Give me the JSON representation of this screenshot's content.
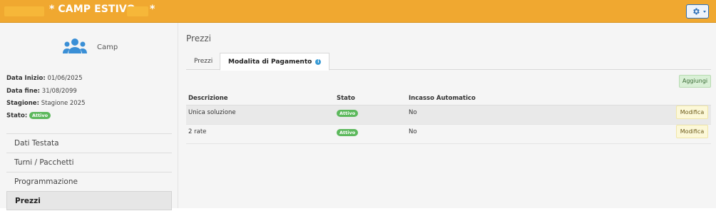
{
  "header": {
    "title": "* CAMP ESTIVO",
    "title_suffix": "*",
    "settings_icon": "gear-icon",
    "accent_color": "#f0a830"
  },
  "sidebar": {
    "icon": "users-icon",
    "camp_label": "Camp",
    "info": {
      "start_label": "Data Inizio:",
      "start_value": "01/06/2025",
      "end_label": "Data fine:",
      "end_value": "31/08/2099",
      "season_label": "Stagione:",
      "season_value": "Stagione 2025",
      "status_label": "Stato:",
      "status_value": "Attivo"
    },
    "menu": [
      {
        "label": "Dati Testata"
      },
      {
        "label": "Turni / Pacchetti"
      },
      {
        "label": "Programmazione"
      },
      {
        "label": "Prezzi"
      }
    ]
  },
  "main": {
    "title": "Prezzi",
    "tabs": [
      {
        "label": "Prezzi"
      },
      {
        "label": "Modalita di Pagamento",
        "icon": "info-icon"
      }
    ],
    "add_button": "Aggiungi",
    "table": {
      "headers": [
        "Descrizione",
        "Stato",
        "Incasso Automatico"
      ],
      "rows": [
        {
          "descrizione": "Unica soluzione",
          "stato": "Attivo",
          "incasso": "No",
          "action": "Modifica"
        },
        {
          "descrizione": "2 rate",
          "stato": "Attivo",
          "incasso": "No",
          "action": "Modifica"
        }
      ]
    }
  },
  "colors": {
    "status_active": "#5cb85c",
    "add_button_bg": "#d9f0d6",
    "edit_button_bg": "#fcf8d8"
  }
}
